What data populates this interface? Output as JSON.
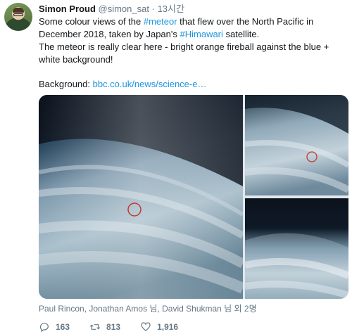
{
  "author": {
    "name": "Simon Proud",
    "handle": "@simon_sat",
    "separator": "·",
    "time": "13시간"
  },
  "tweet": {
    "line1_pre": "Some colour views of the ",
    "line1_tag": "#meteor",
    "line1_post": " that flew over the North Pacific in December 2018, taken by Japan's ",
    "line1_tag2": "#Himawari",
    "line1_end": " satellite.",
    "line2": "The meteor is really clear here - bright orange fireball against the blue + white background!",
    "background_label": "Background: ",
    "background_link": "bbc.co.uk/news/science-e…"
  },
  "media": {
    "images": [
      "satellite-image-main",
      "satellite-image-top-right",
      "satellite-image-bottom-right"
    ],
    "marker_color": "#c0392b"
  },
  "tagged": "Paul Rincon, Jonathan Amos 님, David Shukman 님 외 2명",
  "actions": {
    "reply_count": "163",
    "retweet_count": "813",
    "like_count": "1,916"
  },
  "colors": {
    "link": "#1b95e0",
    "muted": "#657786",
    "text": "#14171a"
  }
}
